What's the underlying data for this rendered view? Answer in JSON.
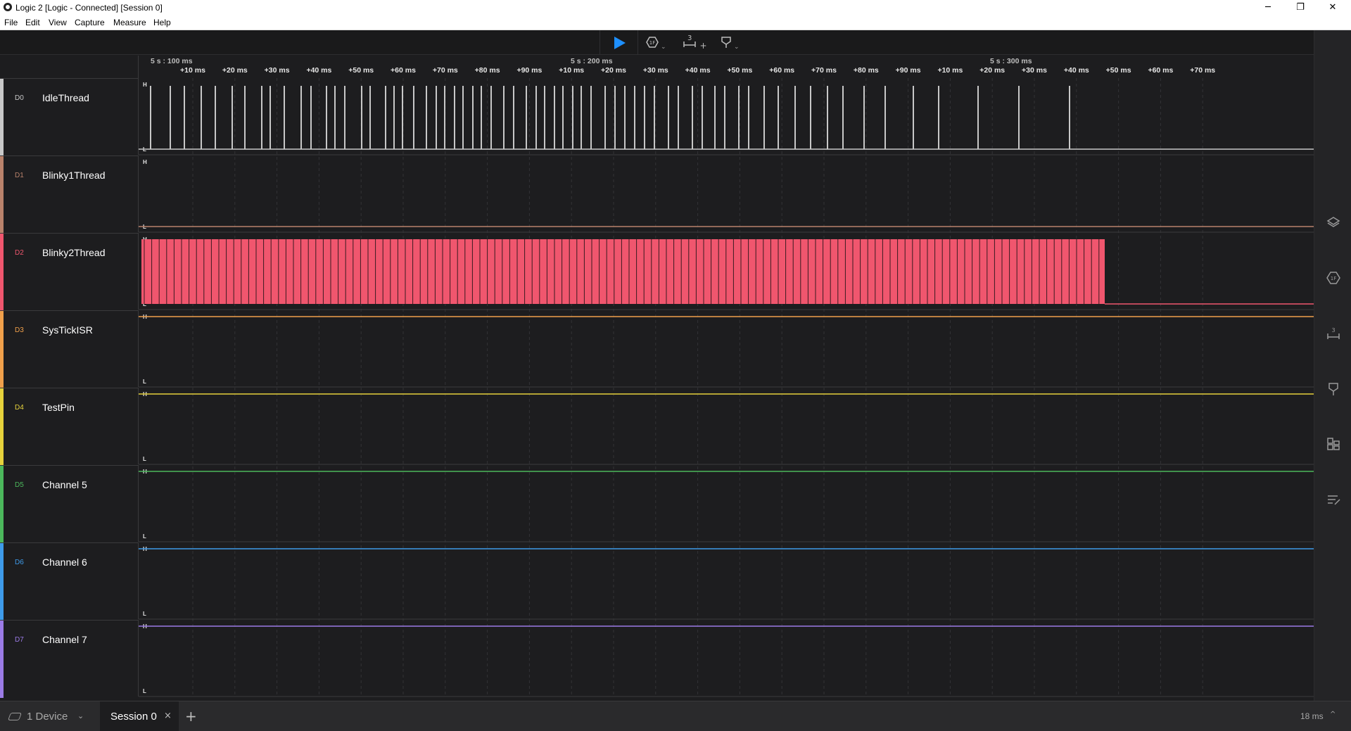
{
  "window": {
    "title": "Logic 2 [Logic - Connected] [Session 0]",
    "minimize": "─",
    "maximize": "❐",
    "close": "✕"
  },
  "menu": [
    "File",
    "Edit",
    "View",
    "Capture",
    "Measure",
    "Help"
  ],
  "toolbar": {
    "play_icon": "play-icon",
    "analyzers_icon": "analyzers-icon",
    "measure_icon": "measure-icon",
    "measure_badge": "3",
    "measure_plus": "+",
    "marker_icon": "marker-icon",
    "chevron": "⌄"
  },
  "ruler": {
    "major": [
      "5 s : 100 ms",
      "5 s : 200 ms",
      "5 s : 300 ms"
    ],
    "minor": [
      "+10 ms",
      "+20 ms",
      "+30 ms",
      "+40 ms",
      "+50 ms",
      "+60 ms",
      "+70 ms",
      "+80 ms",
      "+90 ms",
      "+10 ms",
      "+20 ms",
      "+30 ms",
      "+40 ms",
      "+50 ms",
      "+60 ms",
      "+70 ms",
      "+80 ms",
      "+90 ms",
      "+10 ms",
      "+20 ms",
      "+30 ms",
      "+40 ms",
      "+50 ms",
      "+60 ms",
      "+70 ms"
    ]
  },
  "level_labels": {
    "high": "H",
    "low": "L"
  },
  "channels": [
    {
      "id": "D0",
      "name": "IdleThread",
      "color": "#c8c8c8",
      "state": "pulses"
    },
    {
      "id": "D1",
      "name": "Blinky1Thread",
      "color": "#b9826b",
      "state": "low"
    },
    {
      "id": "D2",
      "name": "Blinky2Thread",
      "color": "#f0566e",
      "state": "dense"
    },
    {
      "id": "D3",
      "name": "SysTickISR",
      "color": "#f0a04b",
      "state": "high"
    },
    {
      "id": "D4",
      "name": "TestPin",
      "color": "#e6d23c",
      "state": "high"
    },
    {
      "id": "D5",
      "name": "Channel 5",
      "color": "#4cb85c",
      "state": "high"
    },
    {
      "id": "D6",
      "name": "Channel 6",
      "color": "#3e9bea",
      "state": "high"
    },
    {
      "id": "D7",
      "name": "Channel 7",
      "color": "#9b7be6",
      "state": "high"
    }
  ],
  "sidebar_icons": [
    "analyzers-panel-icon",
    "extensions-panel-icon",
    "measurements-panel-icon",
    "markers-panel-icon",
    "layout-panel-icon",
    "notes-panel-icon"
  ],
  "bottom": {
    "device_label": "1 Device",
    "session_label": "Session 0",
    "session_close": "×",
    "add_session": "+",
    "zoom_label": "18 ms",
    "zoom_chevron": "^"
  }
}
